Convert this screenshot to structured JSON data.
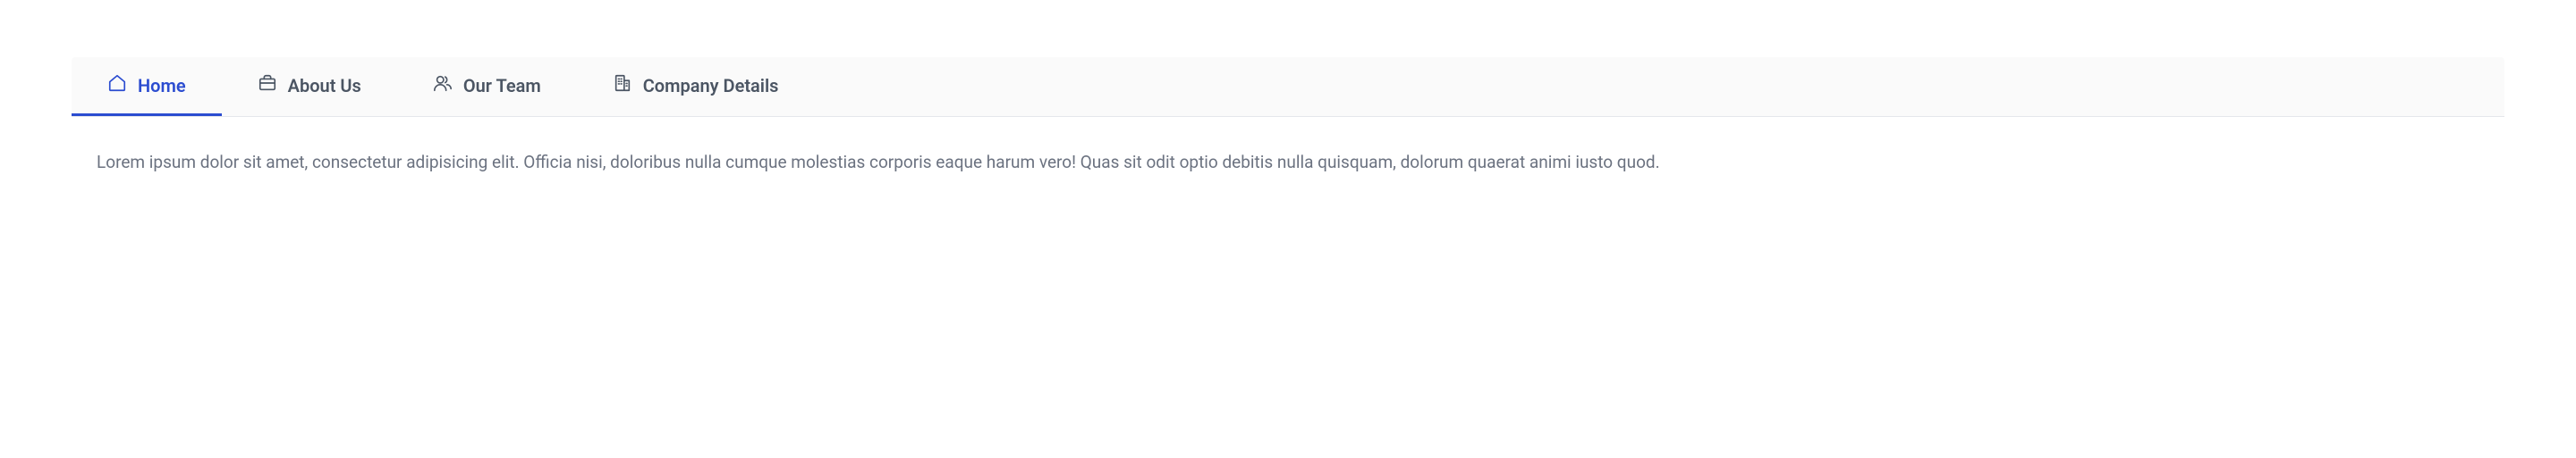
{
  "tabs": [
    {
      "label": "Home",
      "active": true
    },
    {
      "label": "About Us",
      "active": false
    },
    {
      "label": "Our Team",
      "active": false
    },
    {
      "label": "Company Details",
      "active": false
    }
  ],
  "content": {
    "body": "Lorem ipsum dolor sit amet, consectetur adipisicing elit. Officia nisi, doloribus nulla cumque molestias corporis eaque harum vero! Quas sit odit optio debitis nulla quisquam, dolorum quaerat animi iusto quod."
  }
}
